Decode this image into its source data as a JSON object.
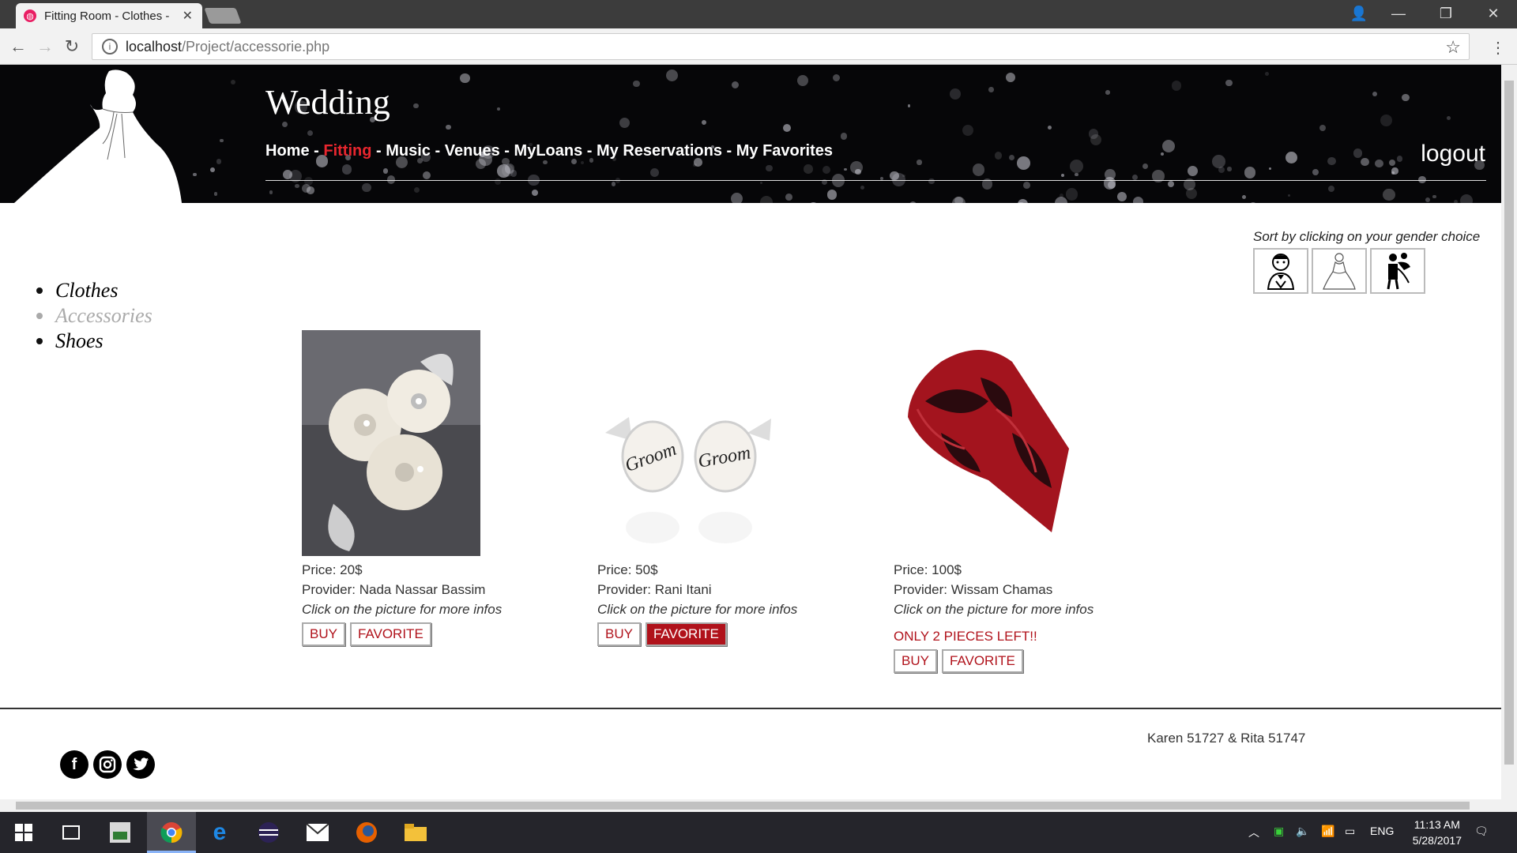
{
  "browser": {
    "tab_title": "Fitting Room - Clothes -",
    "url_host": "localhost",
    "url_path": "/Project/accessorie.php"
  },
  "site": {
    "title": "Wedding",
    "nav": [
      {
        "label": "Home",
        "active": false
      },
      {
        "label": "Fitting",
        "active": true
      },
      {
        "label": "Music",
        "active": false
      },
      {
        "label": "Venues",
        "active": false
      },
      {
        "label": "MyLoans",
        "active": false
      },
      {
        "label": "My Reservations",
        "active": false
      },
      {
        "label": "My Favorites",
        "active": false
      }
    ],
    "logout": "logout"
  },
  "sort": {
    "label": "Sort by clicking on your gender choice",
    "options": [
      "groom-icon",
      "bride-icon",
      "couple-icon"
    ]
  },
  "categories": [
    {
      "label": "Clothes",
      "active": false
    },
    {
      "label": "Accessories",
      "active": true
    },
    {
      "label": "Shoes",
      "active": false
    }
  ],
  "products": [
    {
      "price": "Price: 20$",
      "provider": "Provider: Nada Nassar Bassim",
      "hint": "Click on the picture for more infos",
      "warning": "",
      "buy": "BUY",
      "favorite": "FAVORITE",
      "favorited": false,
      "image": "flower-hairpiece"
    },
    {
      "price": "Price: 50$",
      "provider": "Provider: Rani Itani",
      "hint": "Click on the picture for more infos",
      "warning": "",
      "buy": "BUY",
      "favorite": "FAVORITE",
      "favorited": true,
      "image": "groom-cufflinks"
    },
    {
      "price": "Price: 100$",
      "provider": "Provider: Wissam Chamas",
      "hint": "Click on the picture for more infos",
      "warning": "ONLY 2 PIECES LEFT!!",
      "buy": "BUY",
      "favorite": "FAVORITE",
      "favorited": false,
      "image": "red-paisley-tie"
    }
  ],
  "footer": {
    "credit": "Karen 51727 & Rita 51747",
    "social": [
      "facebook-icon",
      "instagram-icon",
      "twitter-icon"
    ]
  },
  "taskbar": {
    "lang": "ENG",
    "time": "11:13 AM",
    "date": "5/28/2017"
  },
  "colors": {
    "accent": "#b0121b",
    "nav_active": "#e8262e",
    "header_bg": "#060608"
  }
}
